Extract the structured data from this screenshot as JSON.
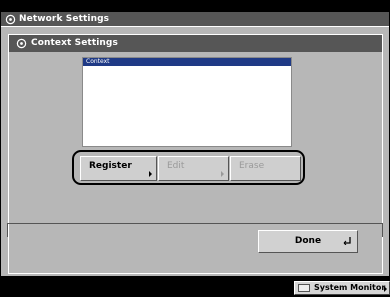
{
  "window": {
    "title": "Network Settings"
  },
  "panel": {
    "title": "Context Settings"
  },
  "context_list": {
    "header": "Context",
    "items": []
  },
  "buttons": {
    "register": "Register",
    "edit": "Edit",
    "erase": "Erase",
    "done": "Done"
  },
  "status_bar": {
    "system_monitor": "System Monitor"
  },
  "icons": {
    "window_title_icon": "settings-gear-icon",
    "panel_title_icon": "settings-gear-icon",
    "done_icon": "enter-return-icon",
    "system_monitor_icon": "monitor-icon"
  },
  "colors": {
    "title_bar": "#565656",
    "list_header": "#1f3a86",
    "panel_bg": "#b7b7b7"
  }
}
